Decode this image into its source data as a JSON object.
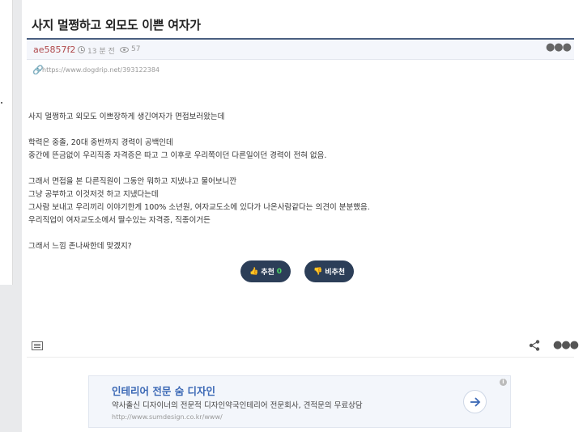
{
  "post": {
    "title": "사지 멀쩡하고 외모도 이쁜 여자가",
    "author": "ae5857f2",
    "time": "13 분 전",
    "views": "57",
    "source_url": "https://www.dogdrip.net/393122384",
    "body_lines": [
      "사지 멀쩡하고 외모도 이쁘장하게 생긴여자가 면접보러왔는데",
      "",
      "학력은 중졸, 20대 중반까지 경력이 공백인데",
      "중간에 뜬금없이 우리직종 자격증은 따고 그 이후로 우리쪽이던 다른일이던 경력이 전혀 없음.",
      "",
      "그래서 면접을 본 다른직원이 그동안 뭐하고 지냈냐고 물어보니깐",
      "그냥 공부하고 이것저것 하고 지냈다는데",
      "그사람 보내고 우리끼리 이야기한게 100% 소년원, 여자교도소에 있다가 나온사람같다는 의견이 분분했음.",
      "우리직업이 여자교도소에서 딸수있는 자격증, 직종이거든",
      "",
      "그래서 느낌 존나싸한데 맞겠지?"
    ]
  },
  "votes": {
    "up_label": "추천",
    "up_count": "0",
    "down_label": "비추천"
  },
  "ad": {
    "title": "인테리어 전문 숨 디자인",
    "description": "약사출신 디자이너의 전문적 디자인약국인테리어 전문회사, 견적문의 무료상담",
    "url": "http://www.sumdesign.co.kr/www/",
    "info_label": "i"
  },
  "icons": {
    "more": "more-dots-icon",
    "link": "link-icon",
    "list": "list-icon",
    "share": "share-icon",
    "arrow": "arrow-right-icon"
  },
  "colors": {
    "accent": "#2c3e58",
    "author": "#b0494c",
    "ad_title": "#3b68b5"
  }
}
